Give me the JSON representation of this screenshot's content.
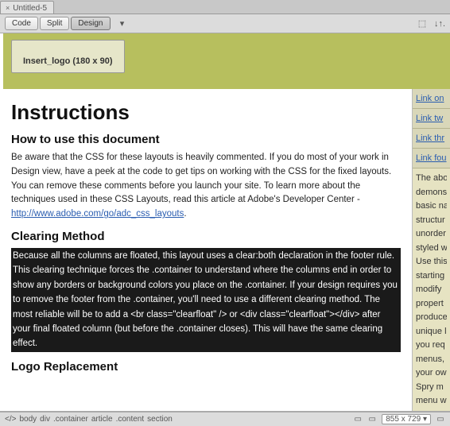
{
  "tab": {
    "title": "Untitled-5"
  },
  "toolbar": {
    "code": "Code",
    "split": "Split",
    "design": "Design"
  },
  "logo": {
    "text": "Insert_logo (180 x 90)"
  },
  "main": {
    "h1": "Instructions",
    "h2a": "How to use this document",
    "p1": "Be aware that the CSS for these layouts is heavily commented. If you do most of your work in Design view, have a peek at the code to get tips on working with the CSS for the fixed layouts. You can remove these comments before you launch your site. To learn more about the techniques used in these CSS Layouts, read this article at Adobe's Developer Center -",
    "link1": "http://www.adobe.com/go/adc_css_layouts",
    "h2b": "Clearing Method",
    "sel": "Because all the columns are floated, this layout uses a clear:both declaration in the footer rule. This clearing technique forces the .container to understand where the columns end in order to show any borders or background colors you place on the .container. If your design requires you to remove the footer from the .container, you'll need to use a different clearing method. The most reliable will be to add a <br class=\"clearfloat\" /> or <div class=\"clearfloat\"></div> after your final floated column (but before the .container closes). This will have the same clearing effect.",
    "h2c": "Logo Replacement"
  },
  "side": {
    "links": [
      "Link on",
      "Link tw",
      "Link thr",
      "Link fou"
    ],
    "desc": [
      "The abo",
      "demons",
      "basic na",
      "structur",
      "unorder",
      "styled w",
      "Use this",
      "starting",
      "modify",
      "propert",
      "produce",
      "unique l",
      "you req",
      "menus,",
      "your ow",
      "Spry m",
      "menu w"
    ]
  },
  "breadcrumb": {
    "items": [
      "body",
      "div",
      ".container",
      "article",
      ".content",
      "section"
    ]
  },
  "status": {
    "size": "855 x 729"
  }
}
